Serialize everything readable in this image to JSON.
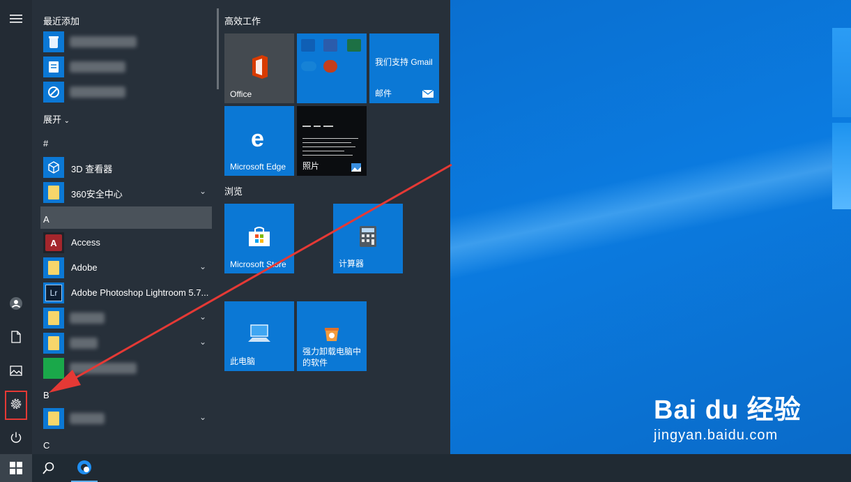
{
  "start_menu": {
    "recent_header": "最近添加",
    "expand_label": "展开",
    "sections": {
      "hash": "#",
      "a": "A",
      "b": "B",
      "c": "C"
    },
    "apps": {
      "viewer3d": "3D 查看器",
      "s360": "360安全中心",
      "access": "Access",
      "adobe": "Adobe",
      "lightroom": "Adobe Photoshop Lightroom 5.7..."
    },
    "icon_text": {
      "access": "A",
      "lightroom": "Lr"
    }
  },
  "tiles": {
    "group_productivity": "高效工作",
    "group_browse": "浏览",
    "office": "Office",
    "gmail": "我们支持 Gmail",
    "mail": "邮件",
    "edge": "Microsoft Edge",
    "photos": "照片",
    "store": "Microsoft Store",
    "calculator": "计算器",
    "this_pc": "此电脑",
    "uninstall_line1": "强力卸载电脑中",
    "uninstall_line2": "的软件"
  },
  "watermark": {
    "logo": "Bai  du 经验",
    "site": "jingyan.baidu.com"
  },
  "colors": {
    "tile": "#0b78d5",
    "start_bg": "#27303a",
    "annotation": "#e53935"
  }
}
